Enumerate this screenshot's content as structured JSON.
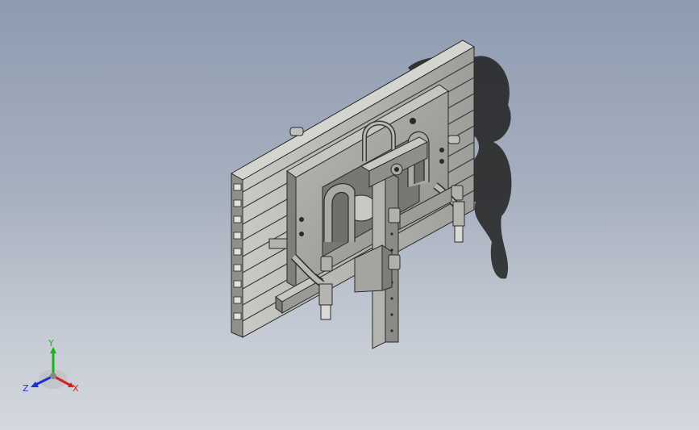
{
  "viewport": {
    "background_top": "#8e9bb0",
    "background_bottom": "#d4d8de"
  },
  "model": {
    "part_color": "#9a9a96",
    "edge_color": "#2a2a2a",
    "shadow_color": "#1f1f1f"
  },
  "triad": {
    "x_label": "X",
    "y_label": "Y",
    "z_label": "Z",
    "x_color": "#d42020",
    "y_color": "#19b419",
    "z_color": "#2030d8"
  }
}
